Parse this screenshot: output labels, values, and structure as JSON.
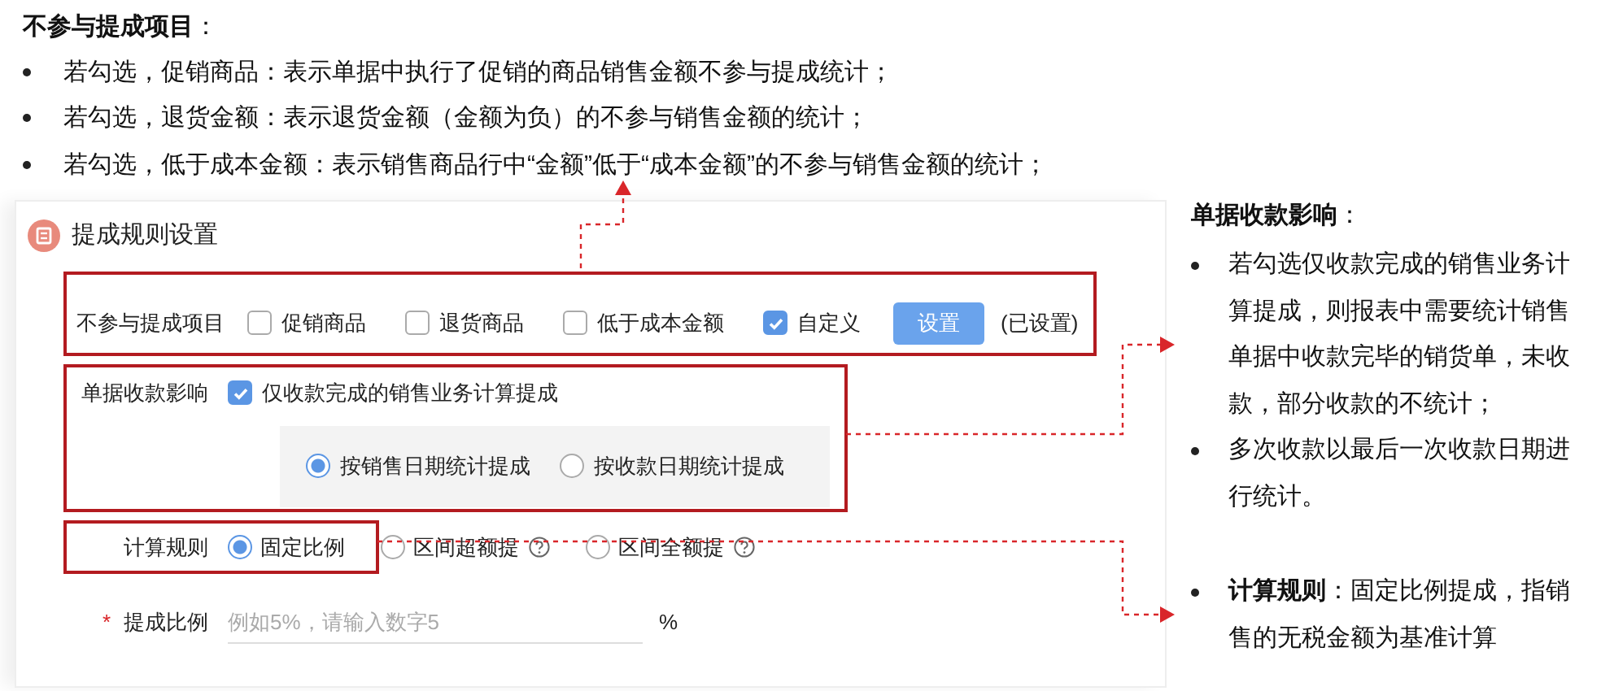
{
  "notes_top": {
    "heading": "**不参与提成项目**：",
    "items": [
      "若勾选，促销商品：表示单据中执行了促销的商品销售金额不参与提成统计；",
      "若勾选，退货金额：表示退货金额（金额为负）的不参与销售金额的统计；",
      "若勾选，低于成本金额：表示销售商品行中“金额”低于“成本金额”的不参与销售金额的统计；"
    ]
  },
  "panel": {
    "title": "提成规则设置",
    "exclude": {
      "label": "不参与提成项目",
      "options": [
        {
          "label": "促销商品",
          "checked": false
        },
        {
          "label": "退货商品",
          "checked": false
        },
        {
          "label": "低于成本金额",
          "checked": false
        },
        {
          "label": "自定义",
          "checked": true
        }
      ],
      "button": "设置",
      "status": "(已设置)"
    },
    "payment": {
      "label": "单据收款影响",
      "option": {
        "label": "仅收款完成的销售业务计算提成",
        "checked": true
      },
      "modes": [
        {
          "label": "按销售日期统计提成",
          "selected": true
        },
        {
          "label": "按收款日期统计提成",
          "selected": false
        }
      ]
    },
    "rule": {
      "label": "计算规则",
      "options": [
        {
          "label": "固定比例",
          "selected": true,
          "help": false
        },
        {
          "label": "区间超额提",
          "selected": false,
          "help": true
        },
        {
          "label": "区间全额提",
          "selected": false,
          "help": true
        }
      ]
    },
    "rate": {
      "label": "提成比例",
      "required_mark": "*",
      "placeholder": "例如5%，请输入数字5",
      "unit": "%"
    }
  },
  "notes_right": [
    {
      "heading": "**单据收款影响**：",
      "items": [
        "若勾选仅收款完成的销售业务计算提成，则报表中需要统计销售单据中收款完毕的销货单，未收款，部分收款的不统计；",
        "多次收款以最后一次收款日期进行统计。"
      ]
    },
    {
      "items": [
        "**计算规则**：固定比例提成，指销售的无税金额为基准计算"
      ]
    }
  ]
}
